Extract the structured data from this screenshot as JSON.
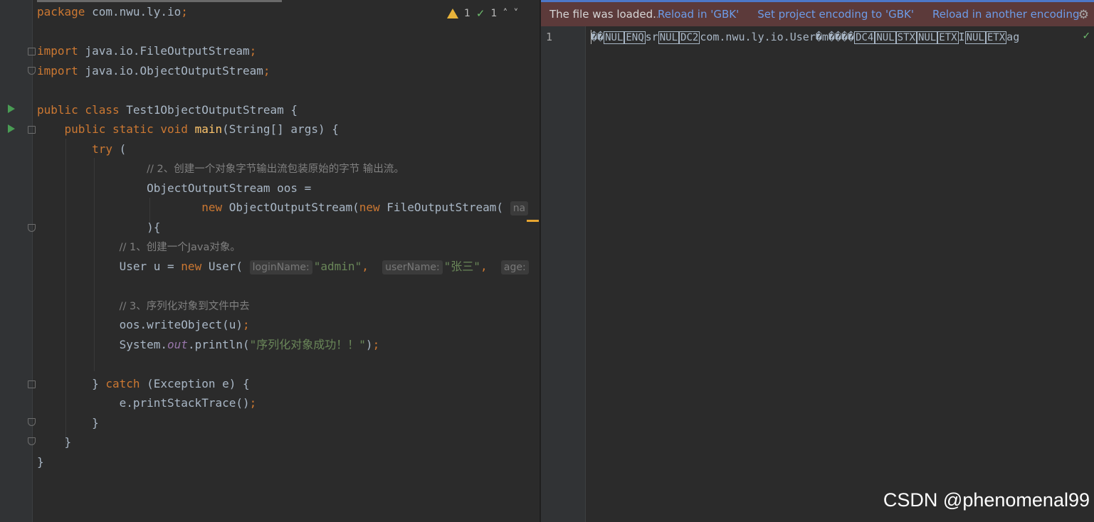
{
  "editor": {
    "lines": [
      [
        "<span class=\"kw\">package</span> com.nwu.ly.io<span class=\"semi\">;</span>"
      ],
      [
        ""
      ],
      [
        "<span class=\"kw\">import</span> java.io.FileOutputStream<span class=\"semi\">;</span>"
      ],
      [
        "<span class=\"kw\">import</span> java.io.ObjectOutputStream<span class=\"semi\">;</span>"
      ],
      [
        ""
      ],
      [
        "<span class=\"kw\">public class</span> Test1ObjectOutputStream {"
      ],
      [
        "    <span class=\"kw\">public static void</span> <span class=\"fn\">main</span>(String[] args) {"
      ],
      [
        "        <span class=\"kw\">try</span> ("
      ],
      [
        "                <span class=\"cmt\">// 2、创建一个对象字节输出流包装原始的字节 输出流。</span>"
      ],
      [
        "                ObjectOutputStream oos ="
      ],
      [
        "                        <span class=\"kw\">new</span> ObjectOutputStream(<span class=\"kw\">new</span> FileOutputStream( <span class=\"hint\">na</span>"
      ],
      [
        "                ){"
      ],
      [
        "            <span class=\"cmt\">// 1、创建一个Java对象。</span>"
      ],
      [
        "            User u = <span class=\"kw\">new</span> User( <span class=\"hint\">loginName:</span><span class=\"str\">\"admin\"</span><span class=\"semi\">,</span>  <span class=\"hint\">userName:</span><span class=\"str\">\"张三\"</span><span class=\"semi\">,</span>  <span class=\"hint\">age:</span>"
      ],
      [
        ""
      ],
      [
        "            <span class=\"cmt\">// 3、序列化对象到文件中去</span>"
      ],
      [
        "            oos.writeObject(u)<span class=\"semi\">;</span>"
      ],
      [
        "            System.<span class=\"fld\">out</span>.println(<span class=\"str\">\"序列化对象成功！！\"</span>)<span class=\"semi\">;</span>"
      ],
      [
        ""
      ],
      [
        "        } <span class=\"kw\">catch</span> (Exception e) {"
      ],
      [
        "            e.printStackTrace()<span class=\"semi\">;</span>"
      ],
      [
        "        }"
      ],
      [
        "    }"
      ],
      [
        "}"
      ]
    ],
    "inspections": {
      "warnings": "1",
      "weak_warnings": "1"
    }
  },
  "viewer": {
    "notification": {
      "message": "The file was loaded...",
      "link_reload": "Reload in 'GBK'",
      "link_set": "Set project encoding to 'GBK'",
      "link_other": "Reload in another encoding"
    },
    "line_number": "1",
    "content_segments": [
      {
        "t": "��"
      },
      {
        "c": "NUL"
      },
      {
        "c": "ENQ"
      },
      {
        "t": "sr"
      },
      {
        "c": "NUL"
      },
      {
        "c": "DC2"
      },
      {
        "t": "com.nwu.ly.io.User�m����"
      },
      {
        "c": "DC4"
      },
      {
        "c": "NUL"
      },
      {
        "c": "STX"
      },
      {
        "c": "NUL"
      },
      {
        "c": "ETX"
      },
      {
        "t": "I"
      },
      {
        "c": "NUL"
      },
      {
        "c": "ETX"
      },
      {
        "t": "ag"
      }
    ]
  },
  "watermark": "CSDN @phenomenal99",
  "colors": {
    "background": "#2b2b2b",
    "gutter": "#313335",
    "keyword": "#cc7832",
    "string": "#6a8759",
    "comment": "#808080",
    "link": "#6d9ce8",
    "notification_bg": "#5c3a3a"
  }
}
